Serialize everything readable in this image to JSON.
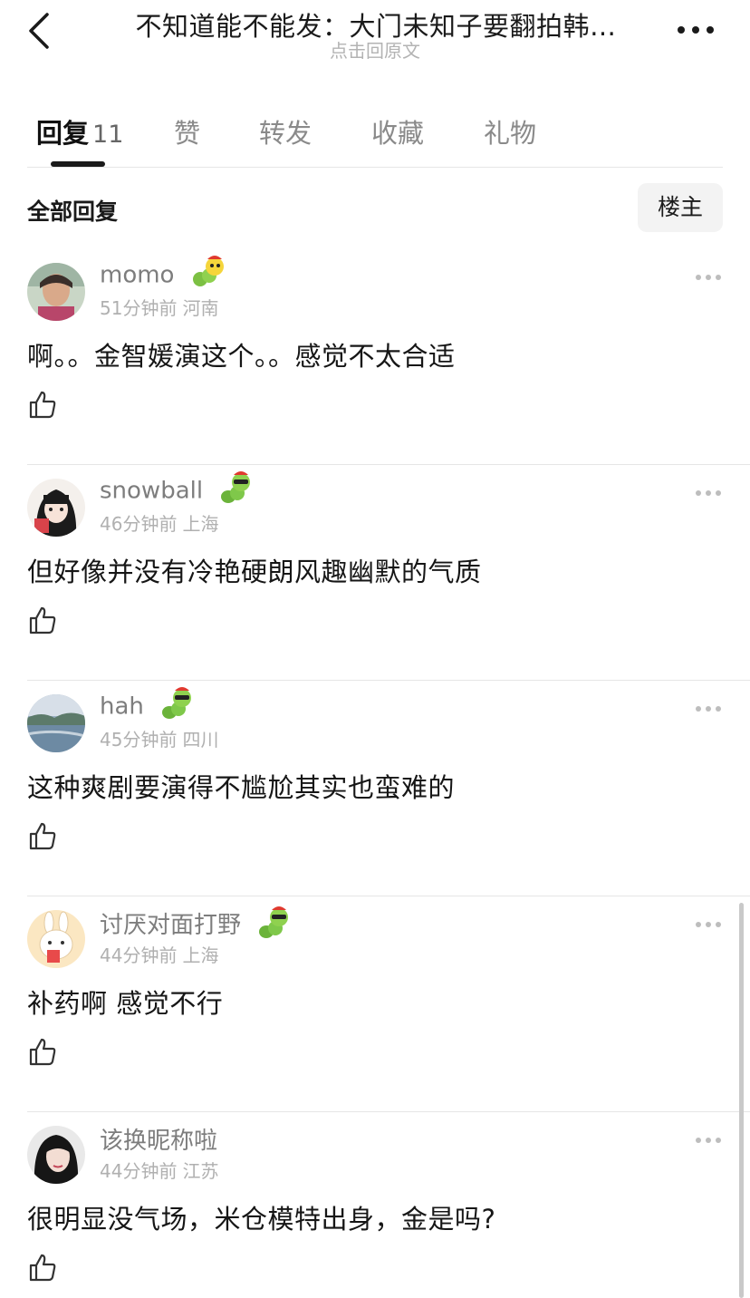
{
  "header": {
    "title": "不知道能不能发：大门未知子要翻拍韩…",
    "subtitle": "点击回原文"
  },
  "tabs": [
    {
      "label": "回复",
      "count": "11",
      "active": true
    },
    {
      "label": "赞",
      "active": false
    },
    {
      "label": "转发",
      "active": false
    },
    {
      "label": "收藏",
      "active": false
    },
    {
      "label": "礼物",
      "active": false
    }
  ],
  "section": {
    "title": "全部回复",
    "owner_button": "楼主"
  },
  "comments": [
    {
      "username": "momo",
      "time": "51分钟前",
      "location": "河南",
      "text": "啊。。金智媛演这个。。感觉不太合适",
      "badge": "caterpillar-badge-icon"
    },
    {
      "username": "snowball",
      "time": "46分钟前",
      "location": "上海",
      "text": "但好像并没有冷艳硬朗风趣幽默的气质",
      "badge": "caterpillar-badge-icon"
    },
    {
      "username": "hah",
      "time": "45分钟前",
      "location": "四川",
      "text": "这种爽剧要演得不尴尬其实也蛮难的",
      "badge": "caterpillar-badge-icon"
    },
    {
      "username": "讨厌对面打野",
      "time": "44分钟前",
      "location": "上海",
      "text": "补药啊 感觉不行",
      "badge": "caterpillar-badge-icon"
    },
    {
      "username": "该换昵称啦",
      "time": "44分钟前",
      "location": "江苏",
      "text": "很明显没气场，米仓模特出身，金是吗?",
      "badge": null
    }
  ],
  "colors": {
    "active_tab": "#111111",
    "inactive_tab": "#8a8a8a",
    "meta_text": "#b0b0b0",
    "divider": "#e6e6e6"
  },
  "icons": [
    "back-arrow-icon",
    "more-dots-icon",
    "like-thumb-icon",
    "caterpillar-badge-icon"
  ]
}
